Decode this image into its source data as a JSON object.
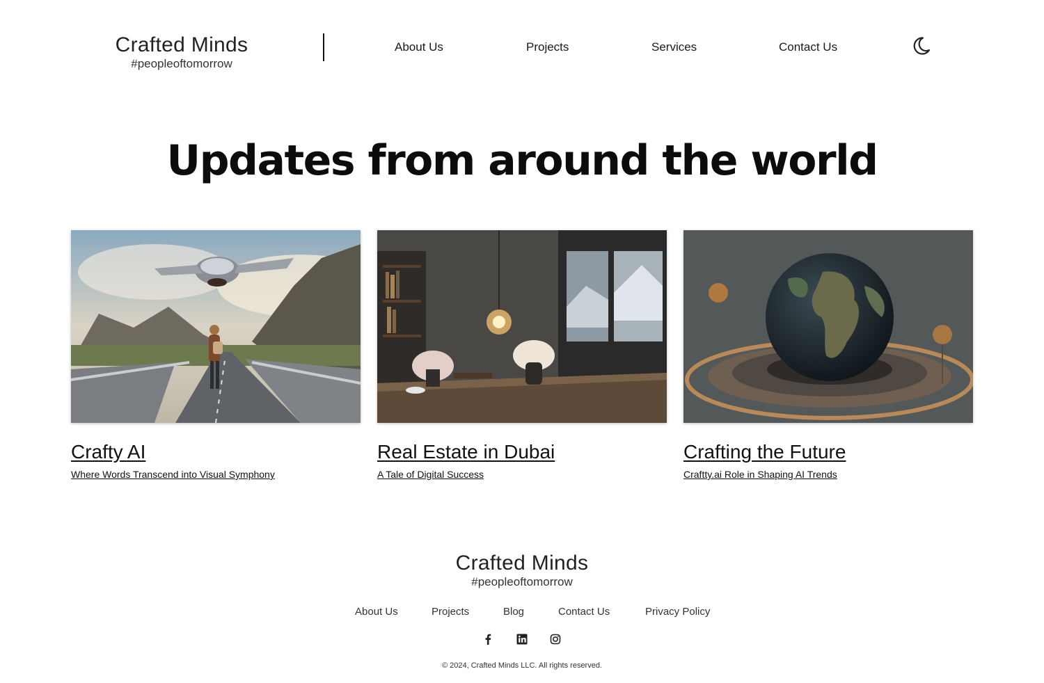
{
  "header": {
    "logo_brand": "Crafted Minds",
    "logo_tag": "#peopleoftomorrow",
    "nav": [
      "About Us",
      "Projects",
      "Services",
      "Contact Us"
    ],
    "theme_toggle_icon": "moon-icon"
  },
  "main": {
    "title": "Updates from around the world",
    "cards": [
      {
        "title": "Crafty AI",
        "subtitle": "Where Words Transcend into Visual Symphony",
        "image": "futuristic-aircraft-road-image"
      },
      {
        "title": "Real Estate in Dubai",
        "subtitle": "A Tale of Digital Success",
        "image": "modern-interior-table-image"
      },
      {
        "title": "Crafting the Future",
        "subtitle": "Craftty.ai Role in Shaping AI Trends",
        "image": "globe-sculpture-image"
      }
    ]
  },
  "footer": {
    "logo_brand": "Crafted Minds",
    "logo_tag": "#peopleoftomorrow",
    "links": [
      "About Us",
      "Projects",
      "Blog",
      "Contact Us",
      "Privacy Policy"
    ],
    "social_icons": [
      "facebook-icon",
      "linkedin-icon",
      "instagram-icon"
    ],
    "copyright": "© 2024, Crafted Minds LLC. All rights reserved."
  }
}
